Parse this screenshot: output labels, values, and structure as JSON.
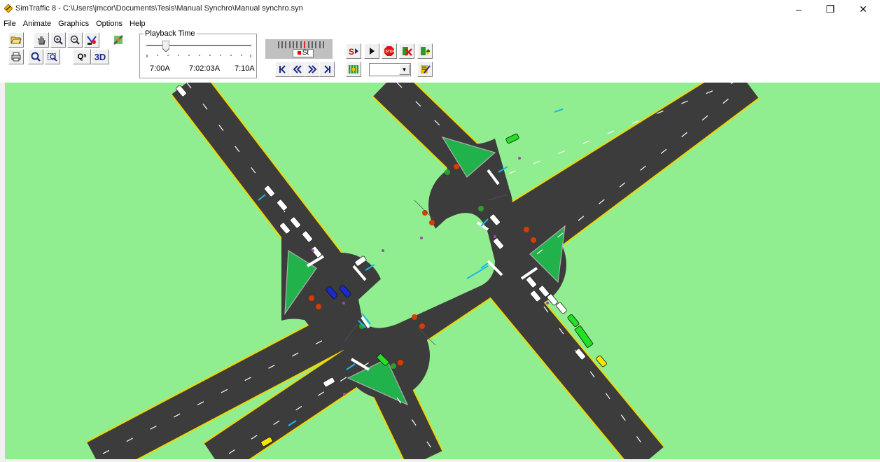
{
  "window": {
    "title": "SimTraffic 8 - C:\\Users\\jmcor\\Documents\\Tesis\\Manual Synchro\\Manual synchro.syn",
    "minimize": "–",
    "maximize": "❐",
    "close": "✕"
  },
  "menu": [
    "File",
    "Animate",
    "Graphics",
    "Options",
    "Help"
  ],
  "toolbar": {
    "playback_label": "Playback Time",
    "time_start": "7:00A",
    "time_current": "7:02:03A",
    "time_end": "7:10A",
    "recorder_status": "St",
    "three_d_label": "3D",
    "zoom_scale_label": "Qˢ",
    "combo_value": ""
  },
  "icons": [
    "open-folder-icon",
    "pan-hand-icon",
    "zoom-in-icon",
    "zoom-out-icon",
    "print-icon",
    "zoom-all-icon",
    "zoom-window-icon",
    "zoom-scale-icon",
    "3d-view-icon",
    "signals-icon",
    "record-icon",
    "play-icon",
    "stop-icon",
    "delete-history-icon",
    "seed-icon",
    "step-start-icon",
    "step-back-icon",
    "step-forward-icon",
    "step-end-icon",
    "network-icon",
    "map-settings-icon"
  ],
  "colors": {
    "grass": "#90ee90",
    "road": "#3c3c3c",
    "island": "#22b24c",
    "edge_line": "#f2d600",
    "signal_red": "#d93a00",
    "signal_green": "#2e9e2e"
  },
  "map": {
    "vehicles_white": 24,
    "vehicles_blue": 2,
    "vehicles_green": 4,
    "vehicles_yellow": 2
  }
}
